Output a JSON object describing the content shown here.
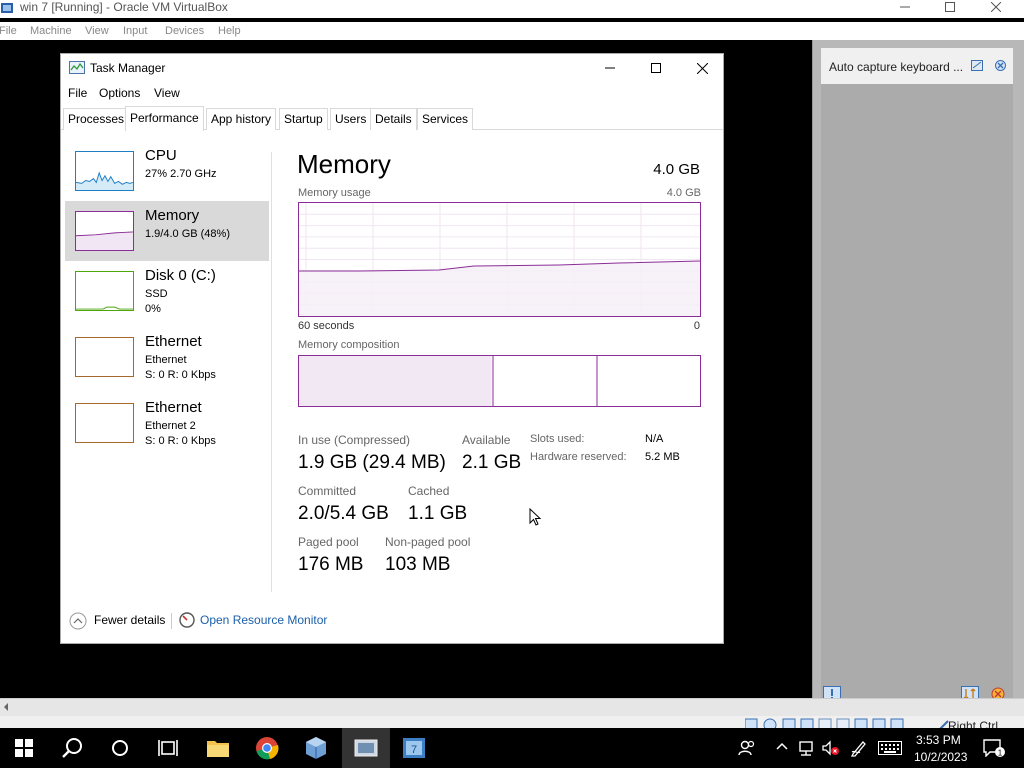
{
  "vbox": {
    "title": "win 7 [Running] - Oracle VM VirtualBox",
    "menus": [
      "File",
      "Machine",
      "View",
      "Input",
      "Devices",
      "Help"
    ],
    "notification": "Auto capture keyboard ...",
    "host_key": "Right Ctrl"
  },
  "task_manager": {
    "title": "Task Manager",
    "menus": [
      "File",
      "Options",
      "View"
    ],
    "tabs": [
      "Processes",
      "Performance",
      "App history",
      "Startup",
      "Users",
      "Details",
      "Services"
    ],
    "active_tab": "Performance",
    "sidebar": [
      {
        "name": "CPU",
        "line1": "27% 2.70 GHz",
        "line2": "",
        "color": "#1f7fc4"
      },
      {
        "name": "Memory",
        "line1": "1.9/4.0 GB (48%)",
        "line2": "",
        "color": "#8b2d98"
      },
      {
        "name": "Disk 0 (C:)",
        "line1": "SSD",
        "line2": "0%",
        "color": "#4da60c"
      },
      {
        "name": "Ethernet",
        "line1": "Ethernet",
        "line2": "S: 0 R: 0 Kbps",
        "color": "#a7692b"
      },
      {
        "name": "Ethernet",
        "line1": "Ethernet 2",
        "line2": "S: 0 R: 0 Kbps",
        "color": "#a7692b"
      }
    ],
    "memory": {
      "heading": "Memory",
      "total": "4.0 GB",
      "usage_label": "Memory usage",
      "usage_max": "4.0 GB",
      "time_left": "60 seconds",
      "time_right": "0",
      "composition_label": "Memory composition",
      "usage_fraction": 0.48,
      "in_use_label": "In use (Compressed)",
      "in_use_value": "1.9 GB (29.4 MB)",
      "available_label": "Available",
      "available_value": "2.1 GB",
      "committed_label": "Committed",
      "committed_value": "2.0/5.4 GB",
      "cached_label": "Cached",
      "cached_value": "1.1 GB",
      "paged_label": "Paged pool",
      "paged_value": "176 MB",
      "nonpaged_label": "Non-paged pool",
      "nonpaged_value": "103 MB",
      "slots_label": "Slots used:",
      "slots_value": "N/A",
      "hw_label": "Hardware reserved:",
      "hw_value": "5.2 MB"
    },
    "footer": {
      "fewer_details": "Fewer details",
      "open_resource_monitor": "Open Resource Monitor"
    }
  },
  "taskbar": {
    "time": "3:53 PM",
    "date": "10/2/2023"
  }
}
